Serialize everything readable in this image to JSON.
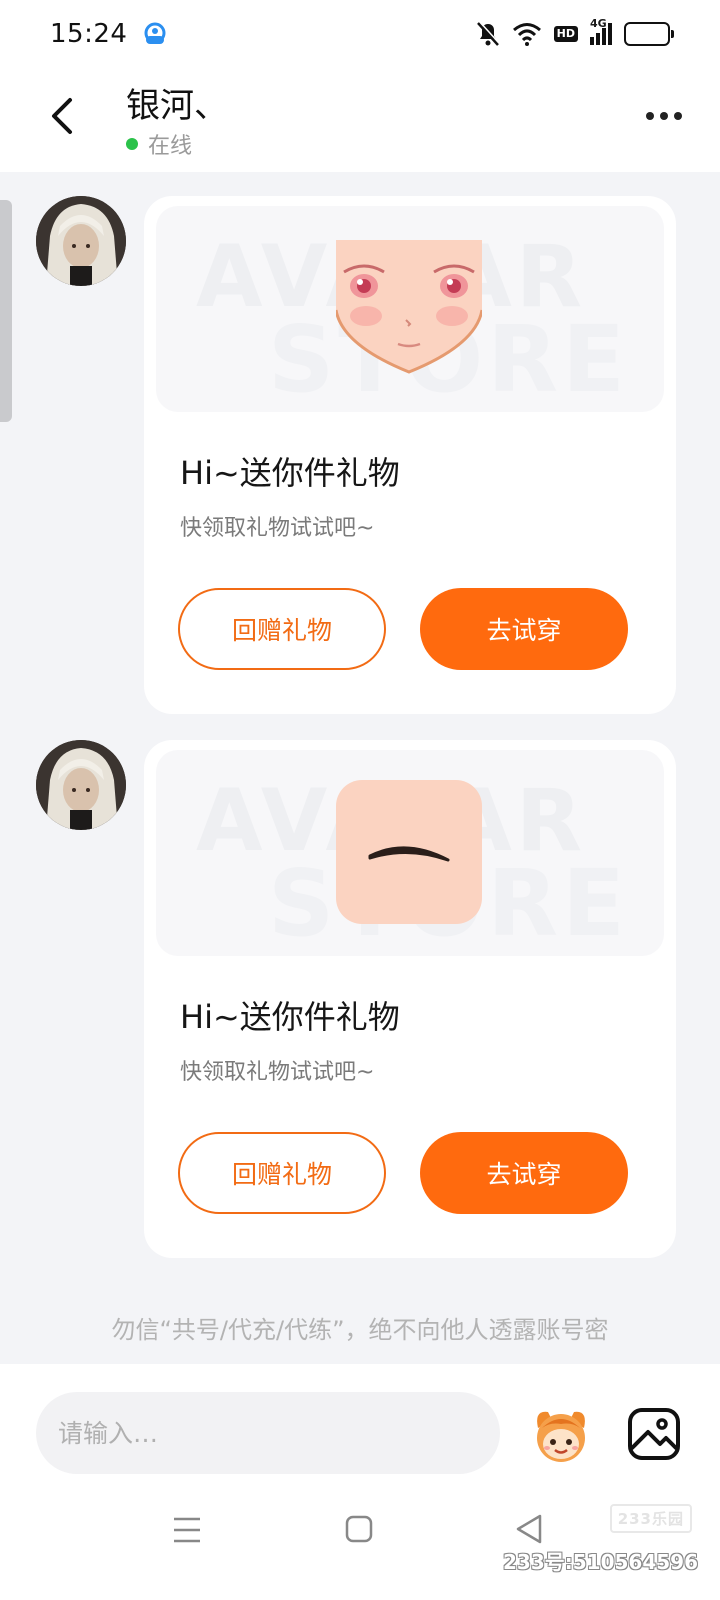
{
  "status_bar": {
    "time": "15:24",
    "app_icon": "cloud-app-icon",
    "icons": [
      "mute-icon",
      "wifi-icon",
      "hd-icon",
      "signal-4g-icon",
      "battery-icon"
    ],
    "hd_label": "HD",
    "network_label": "4G",
    "battery_level": 0.3,
    "battery_color": "#f5c518"
  },
  "header": {
    "back_icon": "chevron-left-icon",
    "contact_name": "银河、",
    "status_text": "在线",
    "status_color": "#2bc24a",
    "more_icon": "more-horizontal-icon"
  },
  "messages": [
    {
      "type": "gift-card",
      "item": "face",
      "watermark_line1": "AVATAR",
      "watermark_line2": "STORE",
      "title": "Hi~送你件礼物",
      "subtitle": "快领取礼物试试吧~",
      "return_button": "回赠礼物",
      "try_button": "去试穿"
    },
    {
      "type": "gift-card",
      "item": "eyebrow",
      "watermark_line1": "AVATAR",
      "watermark_line2": "STORE",
      "title": "Hi~送你件礼物",
      "subtitle": "快领取礼物试试吧~",
      "return_button": "回赠礼物",
      "try_button": "去试穿"
    }
  ],
  "notice": "勿信“共号/代充/代练”，绝不向他人透露账号密",
  "input": {
    "placeholder": "请输入…",
    "value": ""
  },
  "toolbar": {
    "mascot_icon": "mascot-emoji-icon",
    "image_icon": "image-icon"
  },
  "nav": {
    "menu_icon": "menu-icon",
    "home_icon": "home-icon",
    "back_icon": "back-triangle-icon"
  },
  "watermark": {
    "logo": "233乐园",
    "id": "233号:510564596"
  },
  "colors": {
    "accent": "#ff6a0e",
    "accent_outline": "#f26b14",
    "background": "#f3f4f7"
  }
}
